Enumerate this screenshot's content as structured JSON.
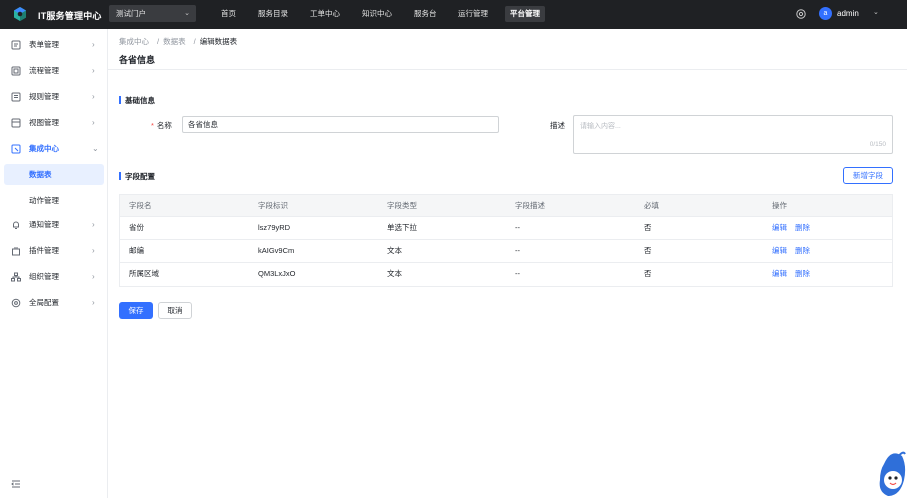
{
  "header": {
    "app_title": "IT服务管理中心",
    "portal_select": "测试门户",
    "nav": [
      "首页",
      "服务目录",
      "工单中心",
      "知识中心",
      "服务台",
      "运行管理",
      "平台管理"
    ],
    "active_nav": "平台管理",
    "user_initial": "a",
    "user_name": "admin"
  },
  "sidebar": {
    "items": [
      {
        "label": "表单管理",
        "icon": "form-icon"
      },
      {
        "label": "流程管理",
        "icon": "flow-icon"
      },
      {
        "label": "规则管理",
        "icon": "rule-icon"
      },
      {
        "label": "视图管理",
        "icon": "view-icon"
      },
      {
        "label": "集成中心",
        "icon": "integration-icon",
        "open": true
      },
      {
        "label": "通知管理",
        "icon": "bell-icon"
      },
      {
        "label": "插件管理",
        "icon": "plugin-icon"
      },
      {
        "label": "组织管理",
        "icon": "org-icon"
      },
      {
        "label": "全局配置",
        "icon": "settings-icon"
      }
    ],
    "sub_items": [
      {
        "label": "数据表",
        "active": true
      },
      {
        "label": "动作管理",
        "active": false
      }
    ]
  },
  "breadcrumb": [
    "集成中心",
    "数据表",
    "编辑数据表"
  ],
  "page_title": "各省信息",
  "basic": {
    "section_title": "基础信息",
    "name_label": "名称",
    "name_value": "各省信息",
    "desc_label": "描述",
    "desc_placeholder": "请输入内容...",
    "desc_count": "0/150"
  },
  "fields": {
    "section_title": "字段配置",
    "add_button": "新增字段",
    "columns": [
      "字段名",
      "字段标识",
      "字段类型",
      "字段描述",
      "必填",
      "操作"
    ],
    "rows": [
      {
        "name": "省份",
        "key": "lsz79yRD",
        "type": "单选下拉",
        "desc": "--",
        "required": "否"
      },
      {
        "name": "邮编",
        "key": "kAIGv9Cm",
        "type": "文本",
        "desc": "--",
        "required": "否"
      },
      {
        "name": "所属区域",
        "key": "QM3LxJxO",
        "type": "文本",
        "desc": "--",
        "required": "否"
      }
    ],
    "edit_label": "编辑",
    "delete_label": "删除"
  },
  "actions": {
    "save": "保存",
    "cancel": "取消"
  },
  "colors": {
    "accent": "#3370ff",
    "topbar": "#1f2124",
    "required": "#f54a45"
  }
}
